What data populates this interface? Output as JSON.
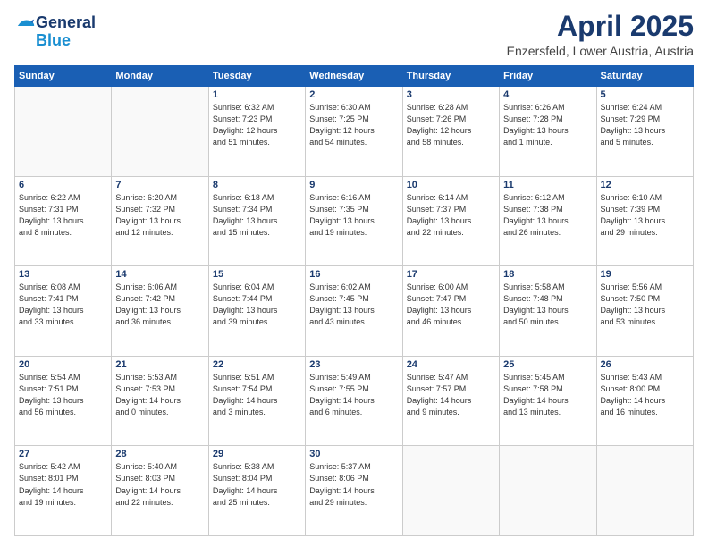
{
  "logo": {
    "general": "General",
    "blue": "Blue"
  },
  "header": {
    "month": "April 2025",
    "location": "Enzersfeld, Lower Austria, Austria"
  },
  "weekdays": [
    "Sunday",
    "Monday",
    "Tuesday",
    "Wednesday",
    "Thursday",
    "Friday",
    "Saturday"
  ],
  "weeks": [
    [
      {
        "day": "",
        "info": ""
      },
      {
        "day": "",
        "info": ""
      },
      {
        "day": "1",
        "info": "Sunrise: 6:32 AM\nSunset: 7:23 PM\nDaylight: 12 hours\nand 51 minutes."
      },
      {
        "day": "2",
        "info": "Sunrise: 6:30 AM\nSunset: 7:25 PM\nDaylight: 12 hours\nand 54 minutes."
      },
      {
        "day": "3",
        "info": "Sunrise: 6:28 AM\nSunset: 7:26 PM\nDaylight: 12 hours\nand 58 minutes."
      },
      {
        "day": "4",
        "info": "Sunrise: 6:26 AM\nSunset: 7:28 PM\nDaylight: 13 hours\nand 1 minute."
      },
      {
        "day": "5",
        "info": "Sunrise: 6:24 AM\nSunset: 7:29 PM\nDaylight: 13 hours\nand 5 minutes."
      }
    ],
    [
      {
        "day": "6",
        "info": "Sunrise: 6:22 AM\nSunset: 7:31 PM\nDaylight: 13 hours\nand 8 minutes."
      },
      {
        "day": "7",
        "info": "Sunrise: 6:20 AM\nSunset: 7:32 PM\nDaylight: 13 hours\nand 12 minutes."
      },
      {
        "day": "8",
        "info": "Sunrise: 6:18 AM\nSunset: 7:34 PM\nDaylight: 13 hours\nand 15 minutes."
      },
      {
        "day": "9",
        "info": "Sunrise: 6:16 AM\nSunset: 7:35 PM\nDaylight: 13 hours\nand 19 minutes."
      },
      {
        "day": "10",
        "info": "Sunrise: 6:14 AM\nSunset: 7:37 PM\nDaylight: 13 hours\nand 22 minutes."
      },
      {
        "day": "11",
        "info": "Sunrise: 6:12 AM\nSunset: 7:38 PM\nDaylight: 13 hours\nand 26 minutes."
      },
      {
        "day": "12",
        "info": "Sunrise: 6:10 AM\nSunset: 7:39 PM\nDaylight: 13 hours\nand 29 minutes."
      }
    ],
    [
      {
        "day": "13",
        "info": "Sunrise: 6:08 AM\nSunset: 7:41 PM\nDaylight: 13 hours\nand 33 minutes."
      },
      {
        "day": "14",
        "info": "Sunrise: 6:06 AM\nSunset: 7:42 PM\nDaylight: 13 hours\nand 36 minutes."
      },
      {
        "day": "15",
        "info": "Sunrise: 6:04 AM\nSunset: 7:44 PM\nDaylight: 13 hours\nand 39 minutes."
      },
      {
        "day": "16",
        "info": "Sunrise: 6:02 AM\nSunset: 7:45 PM\nDaylight: 13 hours\nand 43 minutes."
      },
      {
        "day": "17",
        "info": "Sunrise: 6:00 AM\nSunset: 7:47 PM\nDaylight: 13 hours\nand 46 minutes."
      },
      {
        "day": "18",
        "info": "Sunrise: 5:58 AM\nSunset: 7:48 PM\nDaylight: 13 hours\nand 50 minutes."
      },
      {
        "day": "19",
        "info": "Sunrise: 5:56 AM\nSunset: 7:50 PM\nDaylight: 13 hours\nand 53 minutes."
      }
    ],
    [
      {
        "day": "20",
        "info": "Sunrise: 5:54 AM\nSunset: 7:51 PM\nDaylight: 13 hours\nand 56 minutes."
      },
      {
        "day": "21",
        "info": "Sunrise: 5:53 AM\nSunset: 7:53 PM\nDaylight: 14 hours\nand 0 minutes."
      },
      {
        "day": "22",
        "info": "Sunrise: 5:51 AM\nSunset: 7:54 PM\nDaylight: 14 hours\nand 3 minutes."
      },
      {
        "day": "23",
        "info": "Sunrise: 5:49 AM\nSunset: 7:55 PM\nDaylight: 14 hours\nand 6 minutes."
      },
      {
        "day": "24",
        "info": "Sunrise: 5:47 AM\nSunset: 7:57 PM\nDaylight: 14 hours\nand 9 minutes."
      },
      {
        "day": "25",
        "info": "Sunrise: 5:45 AM\nSunset: 7:58 PM\nDaylight: 14 hours\nand 13 minutes."
      },
      {
        "day": "26",
        "info": "Sunrise: 5:43 AM\nSunset: 8:00 PM\nDaylight: 14 hours\nand 16 minutes."
      }
    ],
    [
      {
        "day": "27",
        "info": "Sunrise: 5:42 AM\nSunset: 8:01 PM\nDaylight: 14 hours\nand 19 minutes."
      },
      {
        "day": "28",
        "info": "Sunrise: 5:40 AM\nSunset: 8:03 PM\nDaylight: 14 hours\nand 22 minutes."
      },
      {
        "day": "29",
        "info": "Sunrise: 5:38 AM\nSunset: 8:04 PM\nDaylight: 14 hours\nand 25 minutes."
      },
      {
        "day": "30",
        "info": "Sunrise: 5:37 AM\nSunset: 8:06 PM\nDaylight: 14 hours\nand 29 minutes."
      },
      {
        "day": "",
        "info": ""
      },
      {
        "day": "",
        "info": ""
      },
      {
        "day": "",
        "info": ""
      }
    ]
  ]
}
